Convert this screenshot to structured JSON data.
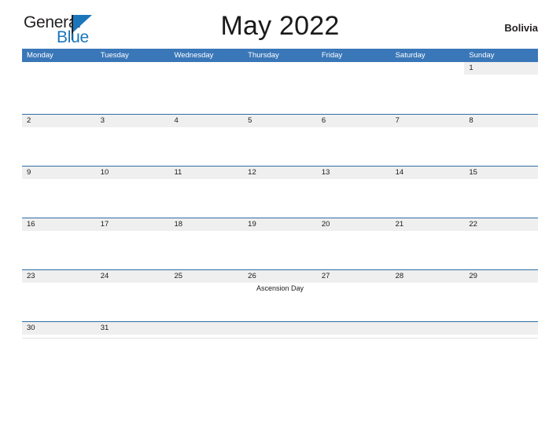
{
  "brand": {
    "name_part1": "General",
    "name_part2": "Blue",
    "flag_icon": "blue-flag-icon"
  },
  "header": {
    "title": "May 2022",
    "locale": "Bolivia"
  },
  "calendar": {
    "weekday_headers": [
      "Monday",
      "Tuesday",
      "Wednesday",
      "Thursday",
      "Friday",
      "Saturday",
      "Sunday"
    ],
    "colors": {
      "header_blue": "#3a77b8",
      "separator_blue": "#2e6da4",
      "day_band_gray": "#efefef",
      "logo_blue": "#1b75bb",
      "text_dark": "#1a1a1a"
    },
    "weeks": [
      {
        "days": [
          {
            "number": "",
            "event": "",
            "filled": false
          },
          {
            "number": "",
            "event": "",
            "filled": false
          },
          {
            "number": "",
            "event": "",
            "filled": false
          },
          {
            "number": "",
            "event": "",
            "filled": false
          },
          {
            "number": "",
            "event": "",
            "filled": false
          },
          {
            "number": "",
            "event": "",
            "filled": false
          },
          {
            "number": "1",
            "event": "",
            "filled": true
          }
        ]
      },
      {
        "days": [
          {
            "number": "2",
            "event": "",
            "filled": true
          },
          {
            "number": "3",
            "event": "",
            "filled": true
          },
          {
            "number": "4",
            "event": "",
            "filled": true
          },
          {
            "number": "5",
            "event": "",
            "filled": true
          },
          {
            "number": "6",
            "event": "",
            "filled": true
          },
          {
            "number": "7",
            "event": "",
            "filled": true
          },
          {
            "number": "8",
            "event": "",
            "filled": true
          }
        ]
      },
      {
        "days": [
          {
            "number": "9",
            "event": "",
            "filled": true
          },
          {
            "number": "10",
            "event": "",
            "filled": true
          },
          {
            "number": "11",
            "event": "",
            "filled": true
          },
          {
            "number": "12",
            "event": "",
            "filled": true
          },
          {
            "number": "13",
            "event": "",
            "filled": true
          },
          {
            "number": "14",
            "event": "",
            "filled": true
          },
          {
            "number": "15",
            "event": "",
            "filled": true
          }
        ]
      },
      {
        "days": [
          {
            "number": "16",
            "event": "",
            "filled": true
          },
          {
            "number": "17",
            "event": "",
            "filled": true
          },
          {
            "number": "18",
            "event": "",
            "filled": true
          },
          {
            "number": "19",
            "event": "",
            "filled": true
          },
          {
            "number": "20",
            "event": "",
            "filled": true
          },
          {
            "number": "21",
            "event": "",
            "filled": true
          },
          {
            "number": "22",
            "event": "",
            "filled": true
          }
        ]
      },
      {
        "days": [
          {
            "number": "23",
            "event": "",
            "filled": true
          },
          {
            "number": "24",
            "event": "",
            "filled": true
          },
          {
            "number": "25",
            "event": "",
            "filled": true
          },
          {
            "number": "26",
            "event": "Ascension Day",
            "filled": true
          },
          {
            "number": "27",
            "event": "",
            "filled": true
          },
          {
            "number": "28",
            "event": "",
            "filled": true
          },
          {
            "number": "29",
            "event": "",
            "filled": true
          }
        ]
      },
      {
        "days": [
          {
            "number": "30",
            "event": "",
            "filled": true
          },
          {
            "number": "31",
            "event": "",
            "filled": true
          },
          {
            "number": "",
            "event": "",
            "filled": true
          },
          {
            "number": "",
            "event": "",
            "filled": true
          },
          {
            "number": "",
            "event": "",
            "filled": true
          },
          {
            "number": "",
            "event": "",
            "filled": true
          },
          {
            "number": "",
            "event": "",
            "filled": true
          }
        ]
      }
    ]
  }
}
